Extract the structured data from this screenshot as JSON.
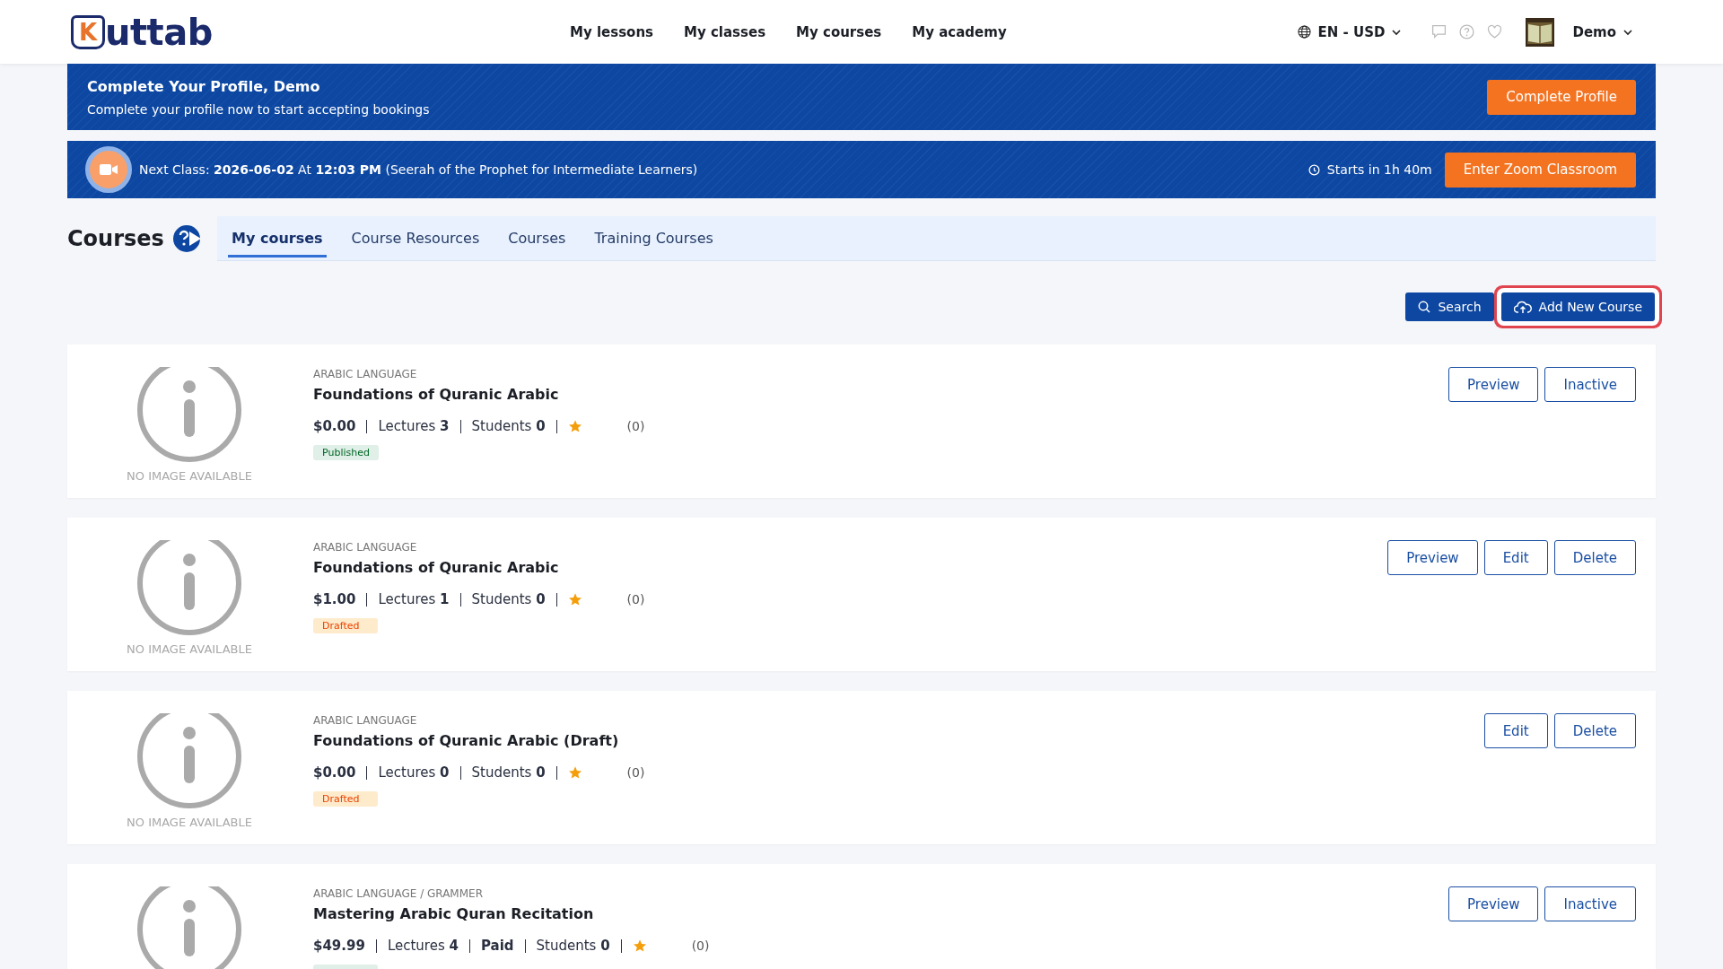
{
  "header": {
    "logo": {
      "initial": "K",
      "text": "uttab"
    },
    "nav": [
      {
        "label": "My lessons"
      },
      {
        "label": "My classes"
      },
      {
        "label": "My courses"
      },
      {
        "label": "My academy"
      }
    ],
    "locale": "EN - USD",
    "user": "Demo"
  },
  "profile_banner": {
    "title": "Complete Your Profile, Demo",
    "text": "Complete your profile now to start accepting bookings",
    "button": "Complete Profile"
  },
  "class_banner": {
    "text": "Next Class: **2026-06-02** At **12:03 PM** (Seerah of the Prophet for Intermediate Learners)",
    "countdown": "Starts in 1h 40m",
    "button": "Enter Zoom Classroom"
  },
  "page": {
    "title": "Courses",
    "tabs": [
      {
        "label": "My courses",
        "selected": true
      },
      {
        "label": "Course Resources",
        "selected": false
      },
      {
        "label": "Courses",
        "selected": false
      },
      {
        "label": "Training Courses",
        "selected": false
      }
    ]
  },
  "toolbar": [
    {
      "label": "Search",
      "kind": "search",
      "highlighted": false
    },
    {
      "label": "Add New Course",
      "kind": "add",
      "highlighted": true
    }
  ],
  "courses": [
    {
      "image_text": "NO IMAGE AVAILABLE",
      "category": "ARABIC LANGUAGE",
      "title": "Foundations of Quranic Arabic",
      "meta": [
        {
          "value": "$0.00"
        },
        {
          "label": "Lectures",
          "value": "3"
        },
        {
          "label": "Students",
          "value": "0"
        }
      ],
      "rating_count": "(0)",
      "badge": {
        "label": "Published",
        "color": "#e0efe8"
      },
      "buttons": [
        "Preview",
        "Inactive"
      ]
    },
    {
      "image_text": "NO IMAGE AVAILABLE",
      "category": "ARABIC LANGUAGE",
      "title": "Foundations of Quranic Arabic",
      "meta": [
        {
          "value": "$1.00"
        },
        {
          "label": "Lectures",
          "value": "1"
        },
        {
          "label": "Students",
          "value": "0"
        }
      ],
      "rating_count": "(0)",
      "badge": {
        "label": "Drafted",
        "color": "#fdebcc"
      },
      "buttons": [
        "Preview",
        "Edit",
        "Delete"
      ]
    },
    {
      "image_text": "NO IMAGE AVAILABLE",
      "category": "ARABIC LANGUAGE",
      "title": "Foundations of Quranic Arabic (Draft)",
      "meta": [
        {
          "value": "$0.00"
        },
        {
          "label": "Lectures",
          "value": "0"
        },
        {
          "label": "Students",
          "value": "0"
        }
      ],
      "rating_count": "(0)",
      "badge": {
        "label": "Drafted",
        "color": "#fdebcc"
      },
      "buttons": [
        "Edit",
        "Delete"
      ]
    },
    {
      "category": "ARABIC LANGUAGE / GRAMMER",
      "title": "Mastering Arabic Quran Recitation",
      "meta": [
        {
          "value": "$49.99"
        },
        {
          "label": "Lectures",
          "value": "4"
        },
        {
          "value": "Paid"
        },
        {
          "label": "Students",
          "value": "0"
        }
      ],
      "rating_count": "(0)",
      "badge": {
        "color": "#e0efe8"
      },
      "buttons": [
        "Preview",
        "Inactive"
      ]
    }
  ]
}
